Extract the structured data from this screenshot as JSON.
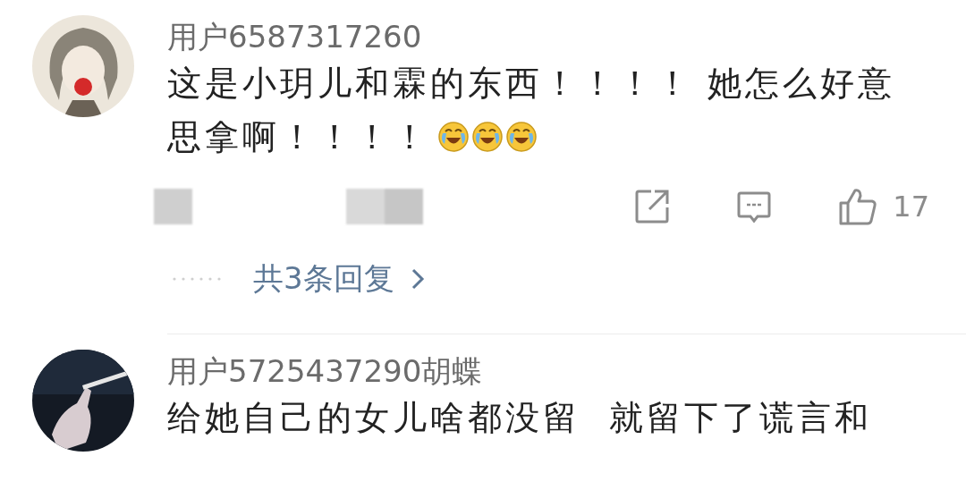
{
  "comments": [
    {
      "username": "用户6587317260",
      "lines": [
        "这是小玥儿和霖的东西！！！！ 她怎么好意",
        "思拿啊！！！！"
      ],
      "emojis": [
        {
          "kind": "laughing-crying"
        },
        {
          "kind": "laughing-crying"
        },
        {
          "kind": "laughing-crying"
        }
      ],
      "likes": "17",
      "replies": "共3条回复"
    },
    {
      "username": "用户5725437290胡蝶",
      "lines": [
        "给她自己的女儿啥都没留  就留下了谎言和"
      ]
    }
  ]
}
